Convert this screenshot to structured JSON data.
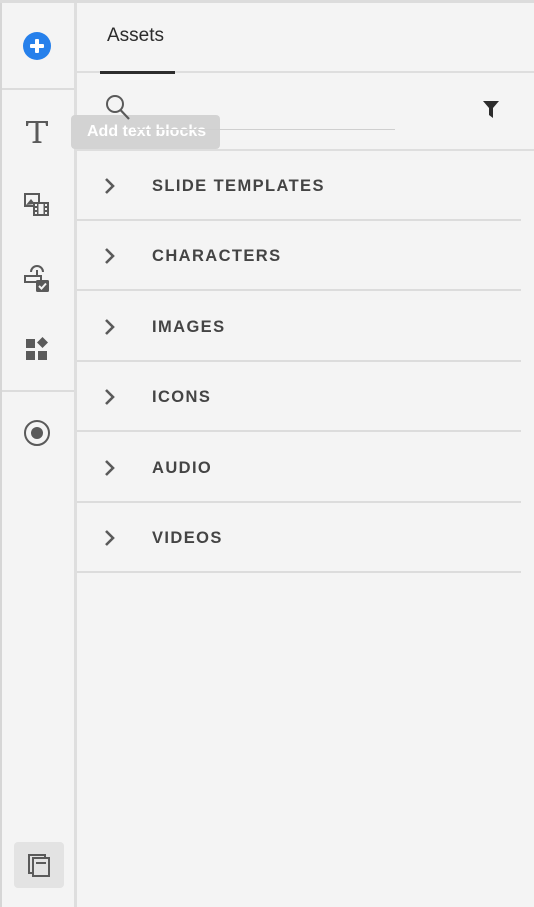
{
  "rail": {
    "tooltip": "Add text blocks"
  },
  "panel": {
    "tab_label": "Assets",
    "search": {
      "placeholder": ""
    },
    "sections": [
      {
        "label": "SLIDE TEMPLATES"
      },
      {
        "label": "CHARACTERS"
      },
      {
        "label": "IMAGES"
      },
      {
        "label": "ICONS"
      },
      {
        "label": "AUDIO"
      },
      {
        "label": "VIDEOS"
      }
    ]
  },
  "colors": {
    "accent": "#2680eb",
    "background": "#f4f4f4",
    "icon": "#5a5a5a"
  },
  "icons": [
    "plus-circle-icon",
    "text-icon",
    "media-icon",
    "interaction-icon",
    "widgets-icon",
    "record-icon",
    "pages-icon",
    "search-icon",
    "filter-icon",
    "chevron-right-icon"
  ]
}
